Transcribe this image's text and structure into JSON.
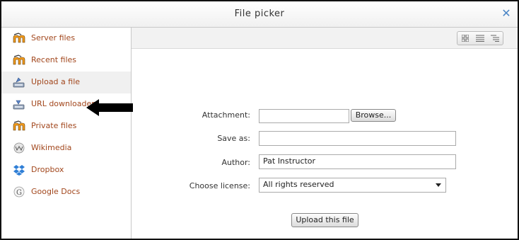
{
  "dialog": {
    "title": "File picker",
    "close_icon": "close-x-icon",
    "accent_color": "#4b86c6"
  },
  "sidebar": {
    "link_color": "#a2471d",
    "items": [
      {
        "label": "Server files",
        "icon": "moodle-icon"
      },
      {
        "label": "Recent files",
        "icon": "moodle-icon"
      },
      {
        "label": "Upload a file",
        "icon": "upload-icon",
        "active": true
      },
      {
        "label": "URL downloader",
        "icon": "url-download-icon"
      },
      {
        "label": "Private files",
        "icon": "moodle-icon"
      },
      {
        "label": "Wikimedia",
        "icon": "wikimedia-icon"
      },
      {
        "label": "Dropbox",
        "icon": "dropbox-icon"
      },
      {
        "label": "Google Docs",
        "icon": "google-icon"
      }
    ]
  },
  "toolbar": {
    "view_buttons": [
      "icons-view-icon",
      "details-view-icon",
      "tree-view-icon"
    ]
  },
  "form": {
    "attachment_label": "Attachment:",
    "attachment_value": "",
    "browse_label": "Browse...",
    "save_as_label": "Save as:",
    "save_as_value": "",
    "author_label": "Author:",
    "author_value": "Pat Instructor",
    "license_label": "Choose license:",
    "license_value": "All rights reserved",
    "upload_label": "Upload this file"
  }
}
